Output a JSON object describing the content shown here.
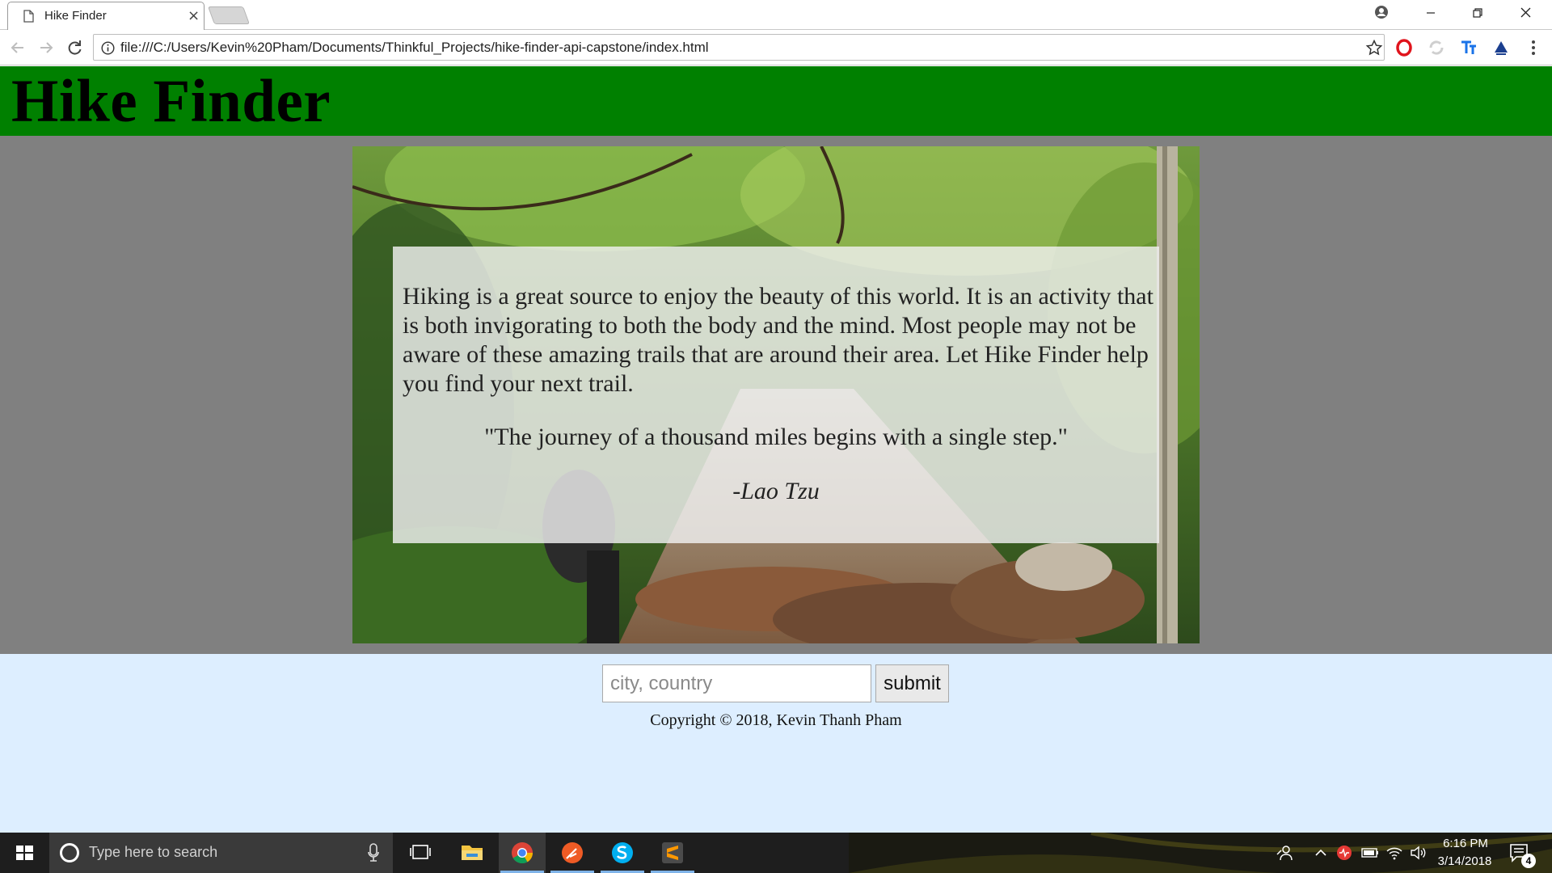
{
  "browser": {
    "tab_title": "Hike Finder",
    "tab_close": "×",
    "url": "file:///C:/Users/Kevin%20Pham/Documents/Thinkful_Projects/hike-finder-api-capstone/index.html"
  },
  "site": {
    "title": "Hike Finder",
    "intro": "Hiking is a great source to enjoy the beauty of this world. It is an activity that is both invigorating to both the body and the mind. Most people may not be aware of these amazing trails that are around their area. Let Hike Finder help you find your next trail.",
    "quote": "\"The journey of a thousand miles begins with a single step.\"",
    "author": "-Lao Tzu",
    "search_placeholder": "city, country",
    "search_value": "",
    "submit_label": "submit",
    "copyright": "Copyright © 2018, Kevin Thanh Pham"
  },
  "taskbar": {
    "search_placeholder": "Type here to search",
    "time": "6:16 PM",
    "date": "3/14/2018",
    "notification_count": "4"
  },
  "icons": {
    "tab": "document-icon",
    "back": "back-arrow-icon",
    "forward": "forward-arrow-icon",
    "reload": "reload-icon",
    "info": "info-icon",
    "bookmark": "star-icon",
    "menu": "kebab-menu-icon"
  },
  "colors": {
    "header_bg": "#008000",
    "hero_band_bg": "#808080",
    "bottom_bg": "#ddeeff",
    "taskbar_bg": "#1e1e1e"
  }
}
